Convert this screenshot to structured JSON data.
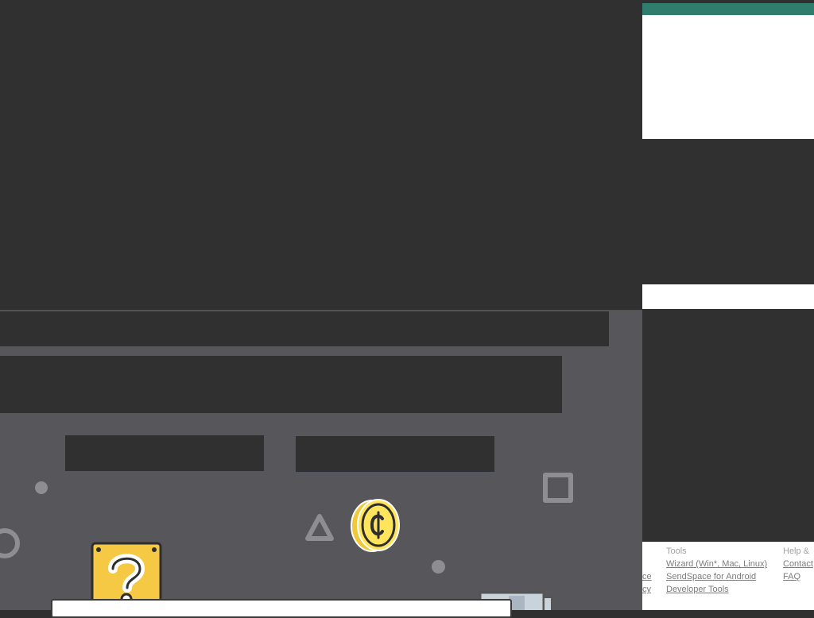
{
  "footer": {
    "columns": [
      {
        "heading": "",
        "links": [
          "ce",
          "cy"
        ]
      },
      {
        "heading": "Tools",
        "links": [
          "Wizard (Win*, Mac, Linux)",
          "SendSpace for Android",
          "Developer Tools"
        ]
      },
      {
        "heading": "Help &",
        "links": [
          "Contact",
          "FAQ"
        ]
      }
    ]
  },
  "icons": {
    "coin": "coin-icon",
    "question_block": "question-block-icon",
    "triangle": "triangle-icon",
    "square": "square-icon",
    "ring": "ring-icon",
    "pipe": "pipe-icon"
  },
  "colors": {
    "page_dark": "#303030",
    "lower_bg": "#57565b",
    "accent": "#2f7d6d",
    "coin_yellow": "#ffe45c",
    "block_yellow": "#f6c945",
    "shape_grey": "#8d8d92"
  }
}
